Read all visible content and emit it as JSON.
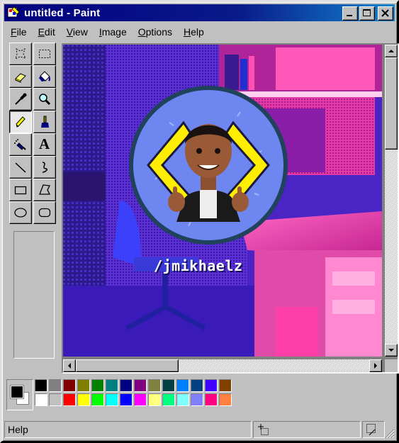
{
  "window": {
    "title": "untitled - Paint"
  },
  "menu": [
    "File",
    "Edit",
    "View",
    "Image",
    "Options",
    "Help"
  ],
  "tools": [
    {
      "name": "free-form-select-icon",
      "active": false
    },
    {
      "name": "rectangle-select-icon",
      "active": false
    },
    {
      "name": "eraser-icon",
      "active": false
    },
    {
      "name": "fill-bucket-icon",
      "active": false
    },
    {
      "name": "color-picker-icon",
      "active": false
    },
    {
      "name": "magnifier-icon",
      "active": false
    },
    {
      "name": "pencil-icon",
      "active": true
    },
    {
      "name": "brush-icon",
      "active": false
    },
    {
      "name": "airbrush-icon",
      "active": false
    },
    {
      "name": "text-tool-icon",
      "active": false
    },
    {
      "name": "line-icon",
      "active": false
    },
    {
      "name": "curve-icon",
      "active": false
    },
    {
      "name": "rectangle-icon",
      "active": false
    },
    {
      "name": "polygon-icon",
      "active": false
    },
    {
      "name": "ellipse-icon",
      "active": false
    },
    {
      "name": "rounded-rectangle-icon",
      "active": false
    }
  ],
  "text_tool_glyph": "A",
  "canvas": {
    "username_text": "/jmikhaelz"
  },
  "colors": {
    "foreground": "#000000",
    "background": "#ffffff",
    "palette_top": [
      "#000000",
      "#808080",
      "#800000",
      "#808000",
      "#008000",
      "#008080",
      "#000080",
      "#800080",
      "#808040",
      "#004040",
      "#0080ff",
      "#004080",
      "#4000ff",
      "#804000"
    ],
    "palette_bottom": [
      "#ffffff",
      "#c0c0c0",
      "#ff0000",
      "#ffff00",
      "#00ff00",
      "#00ffff",
      "#0000ff",
      "#ff00ff",
      "#ffff80",
      "#00ff80",
      "#80ffff",
      "#8080ff",
      "#ff0080",
      "#ff8040"
    ]
  },
  "status": {
    "help_text": "Help"
  }
}
